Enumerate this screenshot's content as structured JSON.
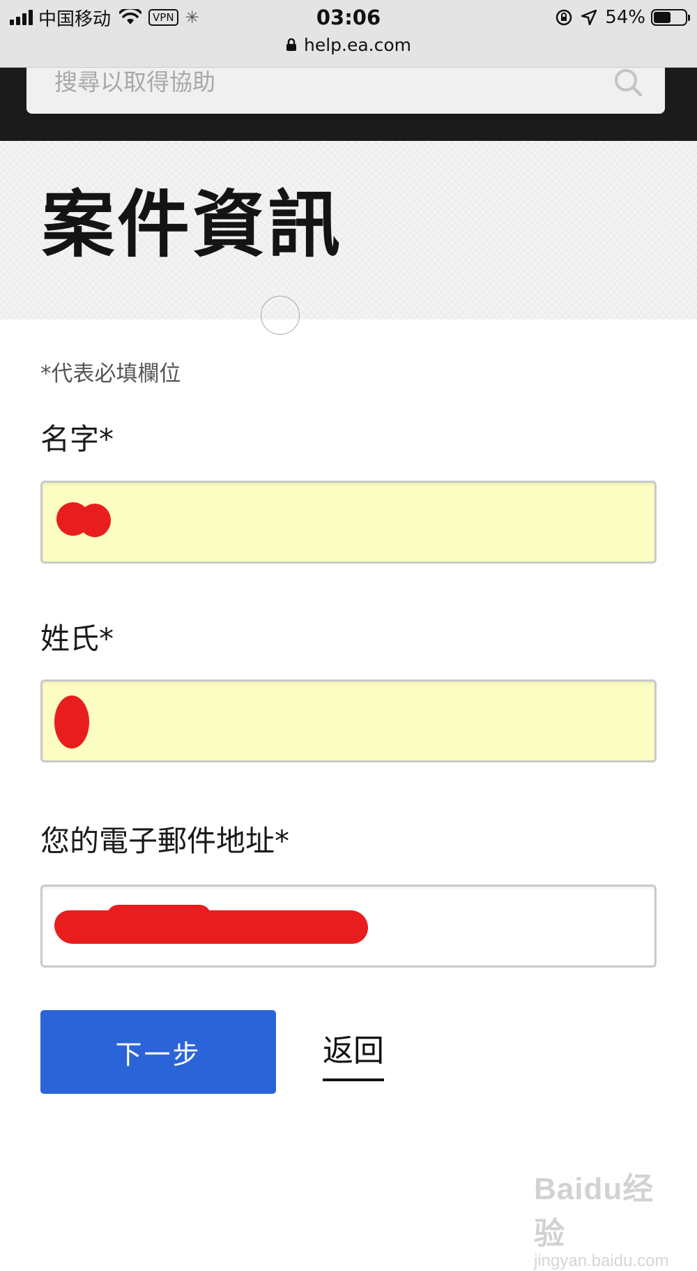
{
  "status_bar": {
    "carrier": "中国移动",
    "vpn_label": "VPN",
    "time": "03:06",
    "battery_percent": "54%",
    "battery_level": 0.54
  },
  "url_bar": {
    "url": "help.ea.com"
  },
  "search": {
    "placeholder": "搜尋以取得協助",
    "icon": "search-icon"
  },
  "hero": {
    "title": "案件資訊"
  },
  "form": {
    "required_note": "*代表必填欄位",
    "first_name": {
      "label": "名字*",
      "value": ""
    },
    "last_name": {
      "label": "姓氏*",
      "value": ""
    },
    "email": {
      "label": "您的電子郵件地址*",
      "value": ""
    }
  },
  "actions": {
    "next_label": "下一步",
    "back_label": "返回"
  },
  "watermark": {
    "logo": "Baidu经验",
    "sub": "jingyan.baidu.com"
  },
  "colors": {
    "header_dark": "#1b1b1b",
    "autofill_bg": "#fbfdc2",
    "primary_button": "#2b63d9",
    "redaction": "#e81e1e"
  }
}
